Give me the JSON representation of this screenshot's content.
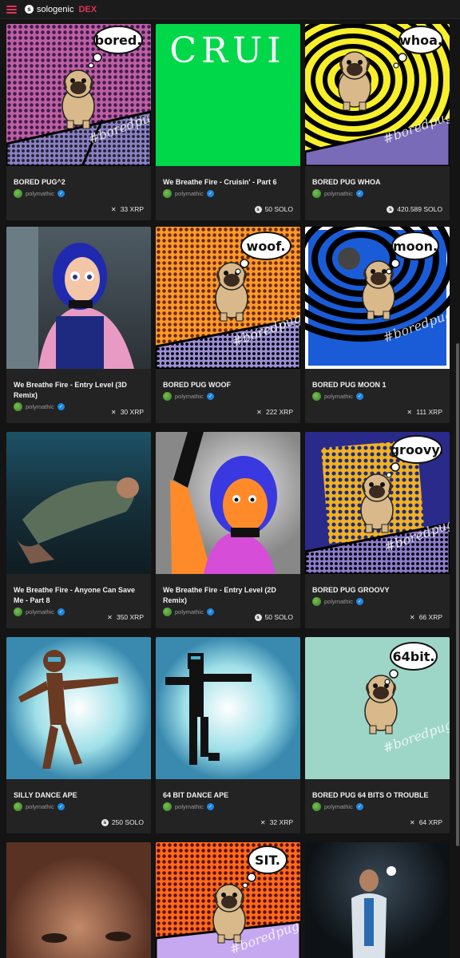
{
  "header": {
    "logo_mark": "s",
    "logo_text": "sologenic",
    "logo_dex": "DEX"
  },
  "currency_icons": {
    "XRP": "✕",
    "SOLO": "s"
  },
  "cards": [
    {
      "title": "BORED PUG^2",
      "creator": "polymathic",
      "price": "33 XRP",
      "currency": "XRP",
      "art": "pug-purple",
      "bubble": "bored."
    },
    {
      "title": "We Breathe Fire - Cruisin' - Part 6",
      "creator": "polymathic",
      "price": "50 SOLO",
      "currency": "SOLO",
      "art": "green-cruise",
      "bubble": "CRUI"
    },
    {
      "title": "BORED PUG WHOA",
      "creator": "polymathic",
      "price": "420.589 SOLO",
      "currency": "SOLO",
      "art": "pug-yellow",
      "bubble": "whoa."
    },
    {
      "title": "We Breathe Fire - Entry Level (3D Remix)",
      "creator": "polymathic",
      "price": "30 XRP",
      "currency": "XRP",
      "art": "girl-3d",
      "bubble": ""
    },
    {
      "title": "BORED PUG WOOF",
      "creator": "polymathic",
      "price": "222 XRP",
      "currency": "XRP",
      "art": "pug-orange",
      "bubble": "woof."
    },
    {
      "title": "BORED PUG MOON 1",
      "creator": "polymathic",
      "price": "111 XRP",
      "currency": "XRP",
      "art": "pug-blue",
      "bubble": "moon."
    },
    {
      "title": "We Breathe Fire - Anyone Can Save Me - Part 8",
      "creator": "polymathic",
      "price": "350 XRP",
      "currency": "XRP",
      "art": "underwater",
      "bubble": ""
    },
    {
      "title": "We Breathe Fire - Entry Level (2D Remix)",
      "creator": "polymathic",
      "price": "50 SOLO",
      "currency": "SOLO",
      "art": "girl-2d",
      "bubble": ""
    },
    {
      "title": "BORED PUG GROOVY",
      "creator": "polymathic",
      "price": "66 XRP",
      "currency": "XRP",
      "art": "pug-groovy",
      "bubble": "groovy."
    },
    {
      "title": "SILLY DANCE APE",
      "creator": "polymathic",
      "price": "250 SOLO",
      "currency": "SOLO",
      "art": "ape-brown",
      "bubble": ""
    },
    {
      "title": "64 BIT DANCE APE",
      "creator": "polymathic",
      "price": "32 XRP",
      "currency": "XRP",
      "art": "ape-pixel",
      "bubble": ""
    },
    {
      "title": "BORED PUG 64 BITS O TROUBLE",
      "creator": "polymathic",
      "price": "64 XRP",
      "currency": "XRP",
      "art": "pug-teal",
      "bubble": "64bit."
    },
    {
      "title": "",
      "creator": "",
      "price": "",
      "currency": "",
      "art": "face",
      "bubble": ""
    },
    {
      "title": "",
      "creator": "",
      "price": "",
      "currency": "",
      "art": "pug-sit",
      "bubble": "SIT."
    },
    {
      "title": "",
      "creator": "",
      "price": "",
      "currency": "",
      "art": "man-dark",
      "bubble": ""
    }
  ]
}
